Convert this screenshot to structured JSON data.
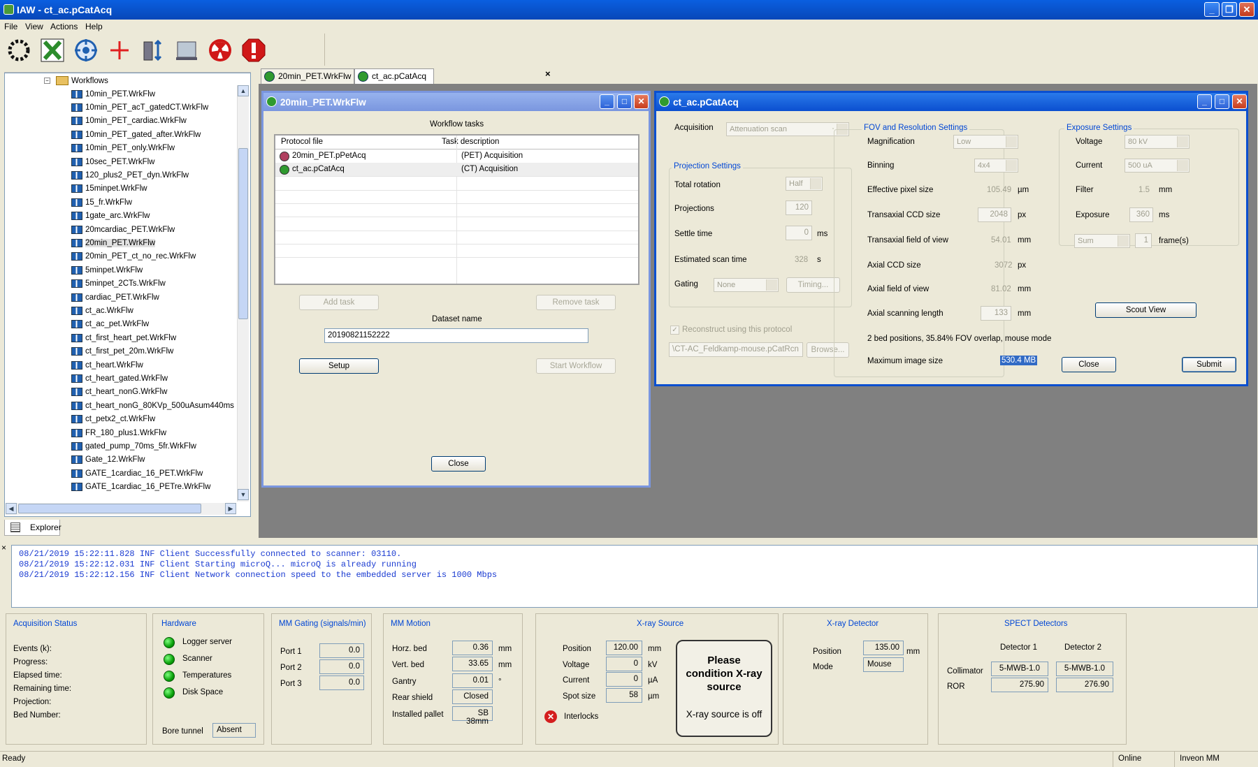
{
  "app": {
    "title": "IAW - ct_ac.pCatAcq"
  },
  "menu": [
    "File",
    "View",
    "Actions",
    "Help"
  ],
  "toolbar": [
    {
      "name": "dotted-ring-icon",
      "color": "#111111"
    },
    {
      "name": "x-icon",
      "color": "#2c8c2c"
    },
    {
      "name": "crosshair-icon",
      "color": "#2060b0"
    },
    {
      "name": "red-cross-icon",
      "color": "#e02020"
    },
    {
      "name": "scanner-icon",
      "color": "#334455"
    },
    {
      "name": "monitor-icon",
      "color": "#556677"
    },
    {
      "name": "radiation-icon",
      "color": "#d01818"
    },
    {
      "name": "stop-icon",
      "color": "#d01818"
    }
  ],
  "explorer": {
    "root": "Workflows",
    "items": [
      "10min_PET.WrkFlw",
      "10min_PET_acT_gatedCT.WrkFlw",
      "10min_PET_cardiac.WrkFlw",
      "10min_PET_gated_after.WrkFlw",
      "10min_PET_only.WrkFlw",
      "10sec_PET.WrkFlw",
      "120_plus2_PET_dyn.WrkFlw",
      "15minpet.WrkFlw",
      "15_fr.WrkFlw",
      "1gate_arc.WrkFlw",
      "20mcardiac_PET.WrkFlw",
      "20min_PET.WrkFlw",
      "20min_PET_ct_no_rec.WrkFlw",
      "5minpet.WrkFlw",
      "5minpet_2CTs.WrkFlw",
      "cardiac_PET.WrkFlw",
      "ct_ac.WrkFlw",
      "ct_ac_pet.WrkFlw",
      "ct_first_heart_pet.WrkFlw",
      "ct_first_pet_20m.WrkFlw",
      "ct_heart.WrkFlw",
      "ct_heart_gated.WrkFlw",
      "ct_heart_nonG.WrkFlw",
      "ct_heart_nonG_80KVp_500uAsum440ms",
      "ct_petx2_ct.WrkFlw",
      "FR_180_plus1.WrkFlw",
      "gated_pump_70ms_5fr.WrkFlw",
      "Gate_12.WrkFlw",
      "GATE_1cardiac_16_PET.WrkFlw",
      "GATE_1cardiac_16_PETre.WrkFlw"
    ],
    "selected": "20min_PET.WrkFlw",
    "tab": "Explorer"
  },
  "tabs": [
    "20min_PET.WrkFlw",
    "ct_ac.pCatAcq"
  ],
  "workflow": {
    "title": "20min_PET.WrkFlw",
    "tasks_label": "Workflow tasks",
    "columns": [
      "Protocol file",
      "Task description"
    ],
    "rows": [
      {
        "file": "20min_PET.pPetAcq",
        "desc": "(PET) Acquisition"
      },
      {
        "file": "ct_ac.pCatAcq",
        "desc": "(CT) Acquisition"
      }
    ],
    "add_task": "Add task",
    "remove_task": "Remove task",
    "dataset_label": "Dataset name",
    "dataset_value": "20190821152222",
    "setup": "Setup",
    "start": "Start Workflow",
    "close": "Close"
  },
  "ct": {
    "title": "ct_ac.pCatAcq",
    "acquisition_label": "Acquisition",
    "acquisition_value": "Attenuation scan",
    "projection": {
      "title": "Projection Settings",
      "total_rotation_label": "Total rotation",
      "total_rotation": "Half",
      "projections_label": "Projections",
      "projections": "120",
      "settle_label": "Settle time",
      "settle": "0",
      "settle_unit": "ms",
      "scan_time_label": "Estimated scan time",
      "scan_time": "328",
      "scan_time_unit": "s",
      "gating_label": "Gating",
      "gating": "None",
      "timing": "Timing..."
    },
    "reconstruct_label": "Reconstruct using this protocol",
    "recon_file": "\\CT-AC_Feldkamp-mouse.pCatRcn",
    "browse": "Browse...",
    "fov": {
      "title": "FOV and Resolution Settings",
      "magnification_label": "Magnification",
      "magnification": "Low",
      "binning_label": "Binning",
      "binning": "4x4",
      "eff_pixel_label": "Effective pixel size",
      "eff_pixel": "105.49",
      "eff_pixel_unit": "µm",
      "trans_ccd_label": "Transaxial CCD size",
      "trans_ccd": "2048",
      "trans_ccd_unit": "px",
      "trans_fov_label": "Transaxial field of view",
      "trans_fov": "54.01",
      "trans_fov_unit": "mm",
      "axial_ccd_label": "Axial CCD size",
      "axial_ccd": "3072",
      "axial_ccd_unit": "px",
      "axial_fov_label": "Axial field of view",
      "axial_fov": "81.02",
      "axial_fov_unit": "mm",
      "axial_len_label": "Axial scanning length",
      "axial_len": "133",
      "axial_len_unit": "mm",
      "bed_info": "2 bed positions, 35.84% FOV overlap, mouse mode",
      "max_image_label": "Maximum image size",
      "max_image": "530.4 MB"
    },
    "exposure": {
      "title": "Exposure Settings",
      "voltage_label": "Voltage",
      "voltage": "80 kV",
      "current_label": "Current",
      "current": "500 uA",
      "filter_label": "Filter",
      "filter": "1.5",
      "filter_unit": "mm",
      "exposure_label": "Exposure",
      "exposure": "360",
      "exposure_unit": "ms",
      "mode": "Sum",
      "frames": "1",
      "frames_unit": "frame(s)"
    },
    "scout": "Scout View",
    "close": "Close",
    "submit": "Submit"
  },
  "log": [
    "08/21/2019 15:22:11.828 INF Client Successfully connected to scanner: 03110.",
    "08/21/2019 15:22:12.031 INF Client Starting microQ... microQ is already running",
    "08/21/2019 15:22:12.156 INF Client Network connection speed to the embedded server is 1000 Mbps"
  ],
  "acq_status": {
    "title": "Acquisition Status",
    "fields": [
      "Events (k):",
      "Progress:",
      "Elapsed time:",
      "Remaining time:",
      "Projection:",
      "Bed Number:"
    ]
  },
  "hardware": {
    "title": "Hardware",
    "items": [
      "Logger server",
      "Scanner",
      "Temperatures",
      "Disk Space"
    ],
    "bore_label": "Bore tunnel",
    "bore": "Absent"
  },
  "gating": {
    "title": "MM Gating (signals/min)",
    "ports": [
      {
        "label": "Port 1",
        "value": "0.0"
      },
      {
        "label": "Port 2",
        "value": "0.0"
      },
      {
        "label": "Port 3",
        "value": "0.0"
      }
    ]
  },
  "motion": {
    "title": "MM Motion",
    "rows": [
      {
        "label": "Horz. bed",
        "value": "0.36",
        "unit": "mm"
      },
      {
        "label": "Vert. bed",
        "value": "33.65",
        "unit": "mm"
      },
      {
        "label": "Gantry",
        "value": "0.01",
        "unit": "°"
      },
      {
        "label": "Rear shield",
        "value": "Closed",
        "unit": ""
      },
      {
        "label": "Installed pallet",
        "value": "SB 38mm",
        "unit": ""
      }
    ]
  },
  "xray_source": {
    "title": "X-ray Source",
    "rows": [
      {
        "label": "Position",
        "value": "120.00",
        "unit": "mm"
      },
      {
        "label": "Voltage",
        "value": "0",
        "unit": "kV"
      },
      {
        "label": "Current",
        "value": "0",
        "unit": "µA"
      },
      {
        "label": "Spot size",
        "value": "58",
        "unit": "µm"
      }
    ],
    "interlocks": "Interlocks",
    "msg1": "Please condition X-ray source",
    "msg2": "X-ray source is off"
  },
  "xray_detector": {
    "title": "X-ray Detector",
    "position_label": "Position",
    "position": "135.00",
    "position_unit": "mm",
    "mode_label": "Mode",
    "mode": "Mouse"
  },
  "spect": {
    "title": "SPECT Detectors",
    "det1": "Detector 1",
    "det2": "Detector 2",
    "collimator_label": "Collimator",
    "collimator1": "5-MWB-1.0",
    "collimator2": "5-MWB-1.0",
    "ror_label": "ROR",
    "ror1": "275.90",
    "ror2": "276.90"
  },
  "status": {
    "left": "Ready",
    "online": "Online",
    "model": "Inveon MM"
  }
}
